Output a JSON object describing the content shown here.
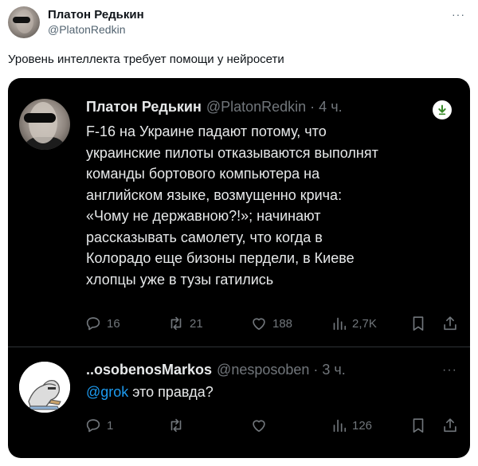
{
  "outer": {
    "name": "Платон Редькин",
    "handle": "@PlatonRedkin",
    "more": "···",
    "text": "Уровень интеллекта требует помощи у нейросети"
  },
  "quoted_tweet": {
    "name": "Платон Редькин",
    "handle_time": "@PlatonRedkin · 4 ч.",
    "body_lines": [
      "F-16 на Украине падают потому, что",
      "украинские пилоты отказываются выполнят",
      "команды бортового компьютера на",
      "английском языке, возмущенно крича:",
      "«Чому не державною?!»; начинают",
      "рассказывать самолету, что когда в",
      "Колорадо еще бизоны пердели, в Киеве",
      "хлопцы уже в тузы гатились"
    ],
    "actions": {
      "replies": "16",
      "reposts": "21",
      "likes": "188",
      "views": "2,7K"
    },
    "download_icon": "download-arrow-icon",
    "accent_color": "#1d9bf0"
  },
  "reply_tweet": {
    "name": "..osobenosMarkos",
    "handle_time": "@nesposoben · 3 ч.",
    "more": "···",
    "mention": "@grok",
    "text": " это правда?",
    "actions": {
      "replies": "1",
      "reposts": "",
      "likes": "",
      "views": "126"
    }
  }
}
